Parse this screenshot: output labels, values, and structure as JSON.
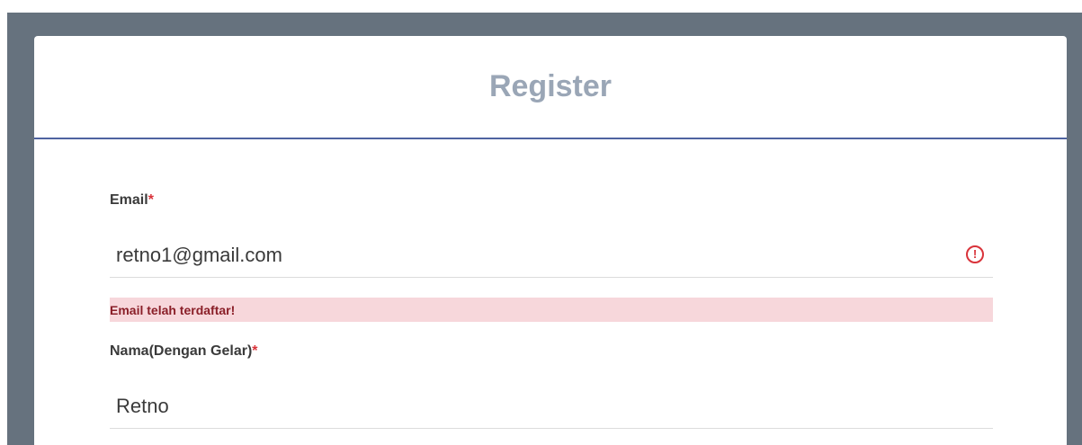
{
  "register_card": {
    "title": "Register"
  },
  "email_field": {
    "label": "Email",
    "required_mark": "*",
    "value": "retno1@gmail.com",
    "error_icon": "exclamation-circle-icon",
    "error_message": "Email telah terdaftar!"
  },
  "name_field": {
    "label": "Nama(Dengan Gelar)",
    "required_mark": "*",
    "value": "Retno"
  },
  "colors": {
    "background_frame": "#66727e",
    "title": "#9aa6b6",
    "header_rule": "#4f63a0",
    "error_red": "#d9333a",
    "error_bg": "#f7d7db",
    "error_text": "#8a1f28"
  }
}
